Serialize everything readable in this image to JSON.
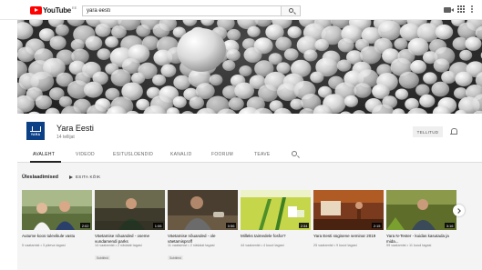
{
  "header": {
    "logo_text": "YouTube",
    "logo_sup": "EE",
    "search_value": "yara eesti",
    "brand_color": "#ff0000",
    "icons": [
      "search-icon",
      "video-camera-icon",
      "apps-grid-icon",
      "more-vert-icon"
    ]
  },
  "channel": {
    "name": "Yara Eesti",
    "subscribers": "14 tellijat",
    "avatar_text": "YARA",
    "subscribe_label": "TELLITUD",
    "avatar_color": "#0b3f86"
  },
  "tabs": [
    {
      "label": "AVALEHT",
      "active": true
    },
    {
      "label": "VIDEOD",
      "active": false
    },
    {
      "label": "ESITUSLOENDID",
      "active": false
    },
    {
      "label": "KANALID",
      "active": false
    },
    {
      "label": "FOORUM",
      "active": false
    },
    {
      "label": "TEAVE",
      "active": false
    }
  ],
  "shelf": {
    "title": "Üleslaadimised",
    "play_all": "ESITA KÕIK",
    "videos": [
      {
        "title": "Autume koos tulevikule vastu",
        "views": "5 vaatamist",
        "age": "3 päeva tagasi",
        "duration": "2:02",
        "badge": ""
      },
      {
        "title": "Väetamise nõuanded - oseme vundamendi parks",
        "views": "14 vaatamist",
        "age": "2 nädalat tagasi",
        "duration": "1:06",
        "badge": "Subtiitrid"
      },
      {
        "title": "Väetamise nõuanded - ole väetamisproff",
        "views": "11 vaatamist",
        "age": "2 nädalat tagasi",
        "duration": "0:56",
        "badge": "Subtiitrid"
      },
      {
        "title": "Milleks taimedele fosfor?",
        "views": "44 vaatamist",
        "age": "4 kuud tagasi",
        "duration": "2:34",
        "badge": ""
      },
      {
        "title": "Yara Eesti sügisene seminar 2019",
        "views": "25 vaatamist",
        "age": "9 kuud tagasi",
        "duration": "2:15",
        "badge": ""
      },
      {
        "title": "Yara N-Tester - kuidas kasutada ja mida...",
        "views": "99 vaatamist",
        "age": "11 kuud tagasi",
        "duration": "3:16",
        "badge": ""
      }
    ]
  }
}
